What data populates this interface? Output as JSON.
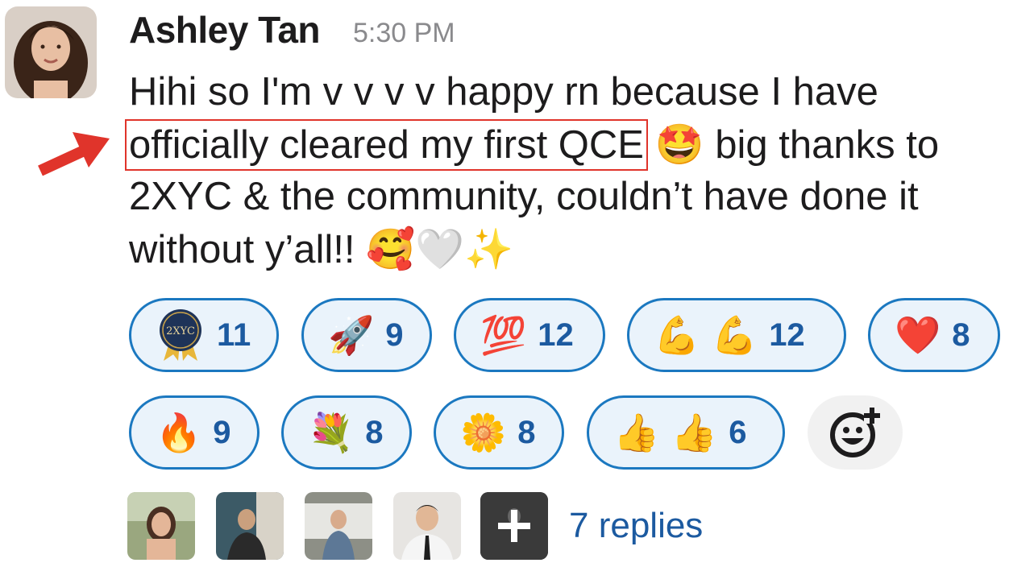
{
  "message": {
    "author": "Ashley Tan",
    "time": "5:30 PM",
    "line1": "Hihi so I'm v v v v happy rn because I have",
    "line2_highlight": "officially cleared my first QCE",
    "line2_emoji": "🤩",
    "line2_rest": "big thanks to",
    "line3": "2XYC & the community, couldn’t have done it",
    "line4_text": "without y’all!!",
    "line4_emojis": "🥰🤍✨"
  },
  "reactions": [
    {
      "emoji": "2XYC",
      "count": "11"
    },
    {
      "emoji": "🚀",
      "count": "9"
    },
    {
      "emoji": "💯",
      "count": "12"
    },
    {
      "emoji": "💪 💪",
      "count": "12"
    },
    {
      "emoji": "❤️",
      "count": "8"
    },
    {
      "emoji": "🔥",
      "count": "9"
    },
    {
      "emoji": "💐",
      "count": "8"
    },
    {
      "emoji": "🌼",
      "count": "8"
    },
    {
      "emoji": "👍 👍",
      "count": "6"
    }
  ],
  "thread": {
    "replies_label": "7 replies"
  },
  "colors": {
    "accent": "#1c5aa0",
    "reaction_border": "#1b78c0",
    "reaction_bg": "#eaf3fb",
    "annotation_red": "#e0342b"
  }
}
